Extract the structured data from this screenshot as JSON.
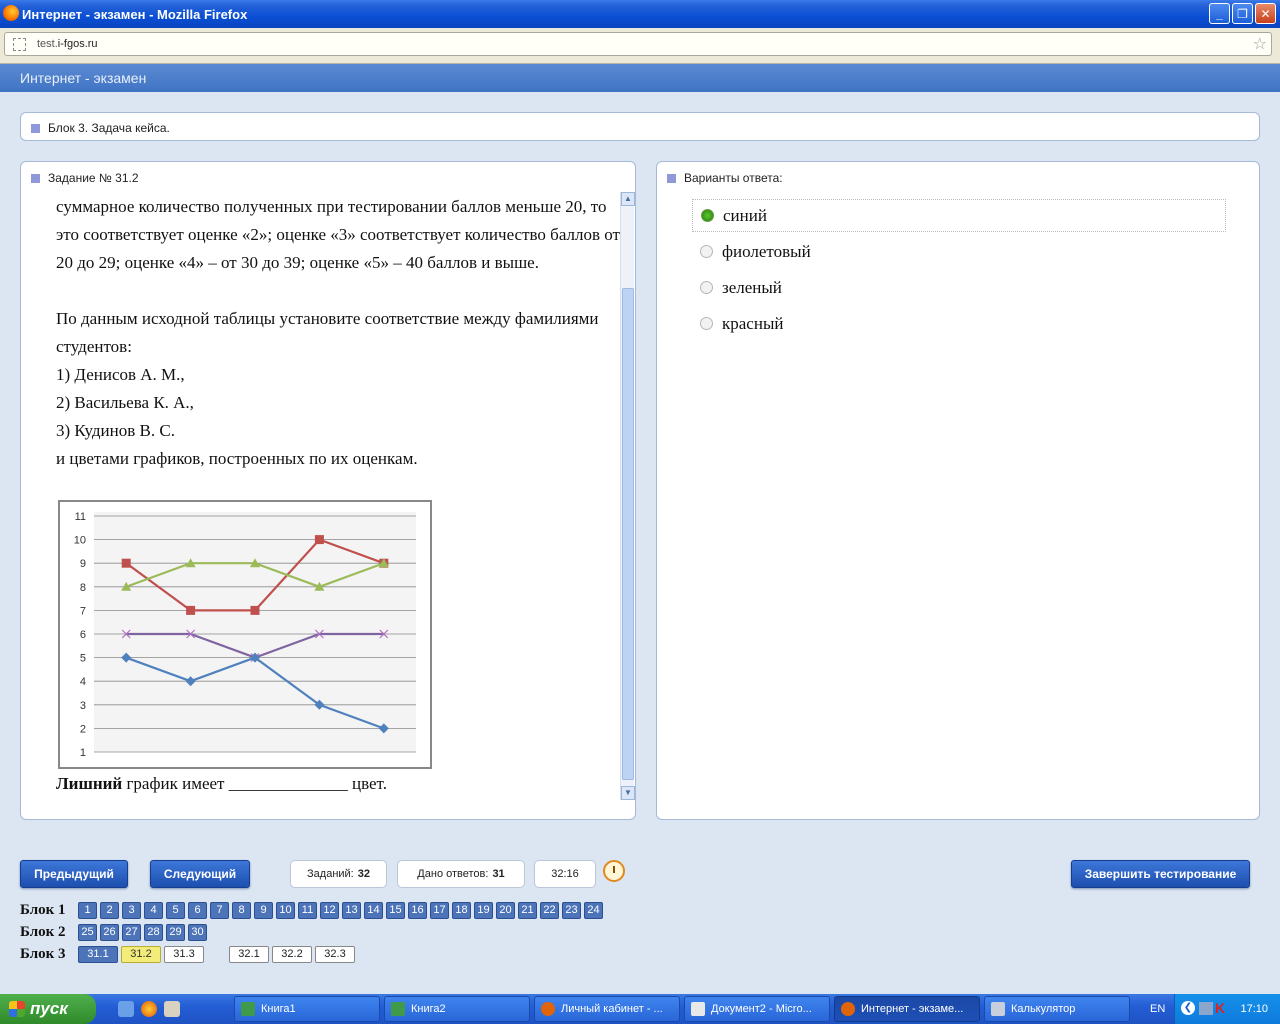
{
  "window": {
    "title": "Интернет - экзамен - Mozilla Firefox",
    "controls": [
      "_",
      "❐",
      "✕"
    ]
  },
  "address": {
    "url_prefix": "test.",
    "url_domain": "i-fgos.ru"
  },
  "app": {
    "header": "Интернет - экзамен"
  },
  "block_bar": {
    "label": "Блок 3. Задача кейса."
  },
  "task": {
    "heading": "Задание № 31.2",
    "paragraph1": "суммарное количество полученных при тестировании баллов меньше 20, то это соответствует оценке «2»; оценке «3» соответствует количество баллов от 20 до 29; оценке «4» – от 30 до 39; оценке «5» – 40 баллов и выше.",
    "paragraph2": "По данным исходной таблицы установите соответствие между фамилиями студентов:",
    "students": [
      "1) Денисов А. М.,",
      "2) Васильева К. А.,",
      "3) Кудинов В. С."
    ],
    "paragraph3": "и цветами графиков, построенных по их оценкам.",
    "caption_bold": "Лишний",
    "caption_rest": " график имеет ______________ цвет."
  },
  "chart_data": {
    "type": "line",
    "x": [
      1,
      2,
      3,
      4,
      5
    ],
    "ylim": [
      1,
      11
    ],
    "yticks": [
      1,
      2,
      3,
      4,
      5,
      6,
      7,
      8,
      9,
      10,
      11
    ],
    "grid": true,
    "series": [
      {
        "color": "#c0504d",
        "marker": "square",
        "values": [
          9,
          7,
          7,
          10,
          9
        ]
      },
      {
        "color": "#9bbb59",
        "marker": "triangle",
        "values": [
          8,
          9,
          9,
          8,
          9
        ]
      },
      {
        "color": "#8064a2",
        "marker": "x",
        "values": [
          6,
          6,
          5,
          6,
          6
        ]
      },
      {
        "color": "#4f81bd",
        "marker": "diamond",
        "values": [
          5,
          4,
          5,
          3,
          2
        ]
      }
    ]
  },
  "answers": {
    "heading": "Варианты ответа:",
    "options": [
      {
        "label": "синий",
        "selected": true
      },
      {
        "label": "фиолетовый",
        "selected": false
      },
      {
        "label": "зеленый",
        "selected": false
      },
      {
        "label": "красный",
        "selected": false
      }
    ]
  },
  "nav": {
    "prev": "Предыдущий",
    "next": "Следующий",
    "tasks_label": "Заданий:",
    "tasks_value": "32",
    "answered_label": "Дано ответов:",
    "answered_value": "31",
    "timer": "32:16",
    "finish": "Завершить тестирование"
  },
  "blocks": {
    "block1_label": "Блок 1",
    "block1": [
      "1",
      "2",
      "3",
      "4",
      "5",
      "6",
      "7",
      "8",
      "9",
      "10",
      "11",
      "12",
      "13",
      "14",
      "15",
      "16",
      "17",
      "18",
      "19",
      "20",
      "21",
      "22",
      "23",
      "24"
    ],
    "block2_label": "Блок 2",
    "block2": [
      "25",
      "26",
      "27",
      "28",
      "29",
      "30"
    ],
    "block3_label": "Блок 3",
    "block3": [
      "31.1",
      "31.2",
      "31.3",
      "32.1",
      "32.2",
      "32.3"
    ]
  },
  "taskbar": {
    "start": "пуск",
    "items": [
      "Книга1",
      "Книга2",
      "Личный кабинет - ...",
      "Документ2 - Micro...",
      "Интернет - экзаме...",
      "Калькулятор"
    ],
    "lang": "EN",
    "time": "17:10"
  }
}
